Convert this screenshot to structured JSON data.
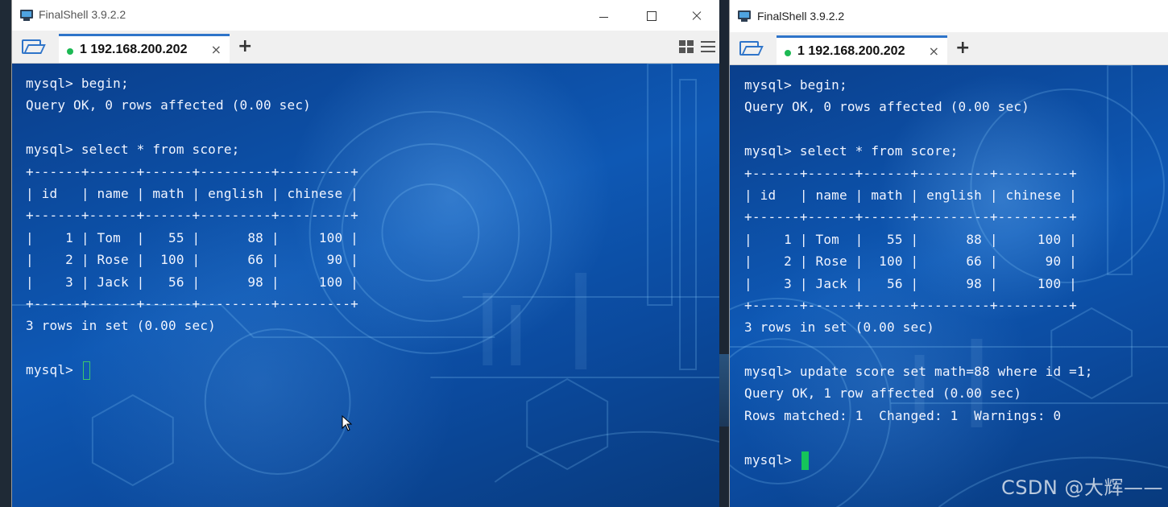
{
  "windows": [
    {
      "title": "FinalShell 3.9.2.2",
      "tab_label": "1 192.168.200.202",
      "tab_close": "×",
      "add_tab": "+",
      "lines": [
        "mysql> begin;",
        "Query OK, 0 rows affected (0.00 sec)",
        "",
        "mysql> select * from score;",
        "+------+------+------+---------+---------+",
        "| id   | name | math | english | chinese |",
        "+------+------+------+---------+---------+",
        "|    1 | Tom  |   55 |      88 |     100 |",
        "|    2 | Rose |  100 |      66 |      90 |",
        "|    3 | Jack |   56 |      98 |     100 |",
        "+------+------+------+---------+---------+",
        "3 rows in set (0.00 sec)",
        ""
      ],
      "prompt": "mysql> "
    },
    {
      "title": "FinalShell 3.9.2.2",
      "tab_label": "1 192.168.200.202",
      "tab_close": "×",
      "add_tab": "+",
      "lines": [
        "mysql> begin;",
        "Query OK, 0 rows affected (0.00 sec)",
        "",
        "mysql> select * from score;",
        "+------+------+------+---------+---------+",
        "| id   | name | math | english | chinese |",
        "+------+------+------+---------+---------+",
        "|    1 | Tom  |   55 |      88 |     100 |",
        "|    2 | Rose |  100 |      66 |      90 |",
        "|    3 | Jack |   56 |      98 |     100 |",
        "+------+------+------+---------+---------+",
        "3 rows in set (0.00 sec)",
        "",
        "mysql> update score set math=88 where id =1;",
        "Query OK, 1 row affected (0.00 sec)",
        "Rows matched: 1  Changed: 1  Warnings: 0",
        ""
      ],
      "prompt": "mysql> "
    }
  ],
  "watermark": "CSDN @大辉——",
  "colors": {
    "terminal_text": "#f0f4ff",
    "tab_accent": "#2e74c9",
    "status_dot": "#1db954",
    "cursor": "#15c45a"
  },
  "icons": [
    "app-icon",
    "folder-open-icon",
    "status-dot-icon",
    "close-icon",
    "plus-icon",
    "layout-grid-icon",
    "menu-icon",
    "minimize-icon",
    "maximize-icon",
    "mouse-pointer-icon"
  ]
}
